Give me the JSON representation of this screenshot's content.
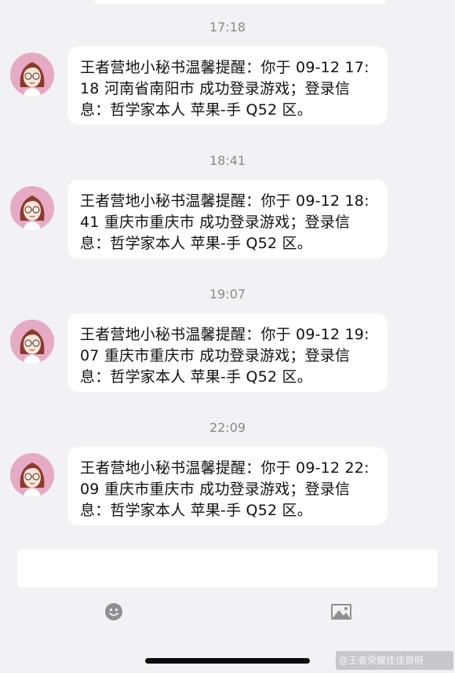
{
  "messages": [
    {
      "time": "17:18",
      "text": "王者营地小秘书温馨提醒：你于 09-12 17:18 河南省南阳市 成功登录游戏；登录信息：哲学家本人 苹果-手 Q52 区。"
    },
    {
      "time": "18:41",
      "text": "王者营地小秘书温馨提醒：你于 09-12 18:41 重庆市重庆市 成功登录游戏；登录信息：哲学家本人 苹果-手 Q52 区。"
    },
    {
      "time": "19:07",
      "text": "王者营地小秘书温馨提醒：你于 09-12 19:07 重庆市重庆市 成功登录游戏；登录信息：哲学家本人 苹果-手 Q52 区。"
    },
    {
      "time": "22:09",
      "text": "王者营地小秘书温馨提醒：你于 09-12 22:09 重庆市重庆市 成功登录游戏；登录信息：哲学家本人 苹果-手 Q52 区。"
    }
  ],
  "input": {
    "value": ""
  },
  "toolbar": {
    "emoji_icon": "emoji-icon",
    "image_icon": "image-icon"
  },
  "watermark": "@王者荣耀佳佳哥呀",
  "colors": {
    "background": "#f2f2f4",
    "bubble": "#ffffff",
    "timestamp": "#8a8a8e",
    "avatar_bg": "#e6aac5",
    "avatar_hair": "#8b3a2b"
  }
}
